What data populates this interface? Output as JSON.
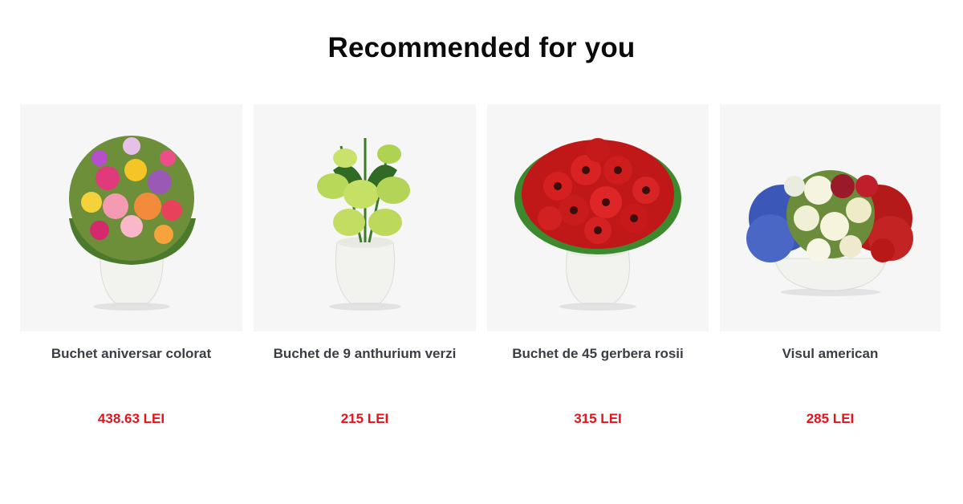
{
  "header": {
    "title": "Recommended for you"
  },
  "colors": {
    "price": "#e8121b",
    "image_background": "#f6f6f6",
    "title": "#0b0b0b",
    "product_name": "#3a3d44"
  },
  "products": [
    {
      "name": "Buchet aniversar colorat",
      "price": "438.63 LEI",
      "image_icon": "colorful-bouquet-vase-icon"
    },
    {
      "name": "Buchet de 9 anthurium verzi",
      "price": "215 LEI",
      "image_icon": "green-anthurium-vase-icon"
    },
    {
      "name": "Buchet de 45 gerbera rosii",
      "price": "315 LEI",
      "image_icon": "red-gerbera-vase-icon"
    },
    {
      "name": "Visul american",
      "price": "285 LEI",
      "image_icon": "red-white-blue-arrangement-bowl-icon"
    }
  ]
}
